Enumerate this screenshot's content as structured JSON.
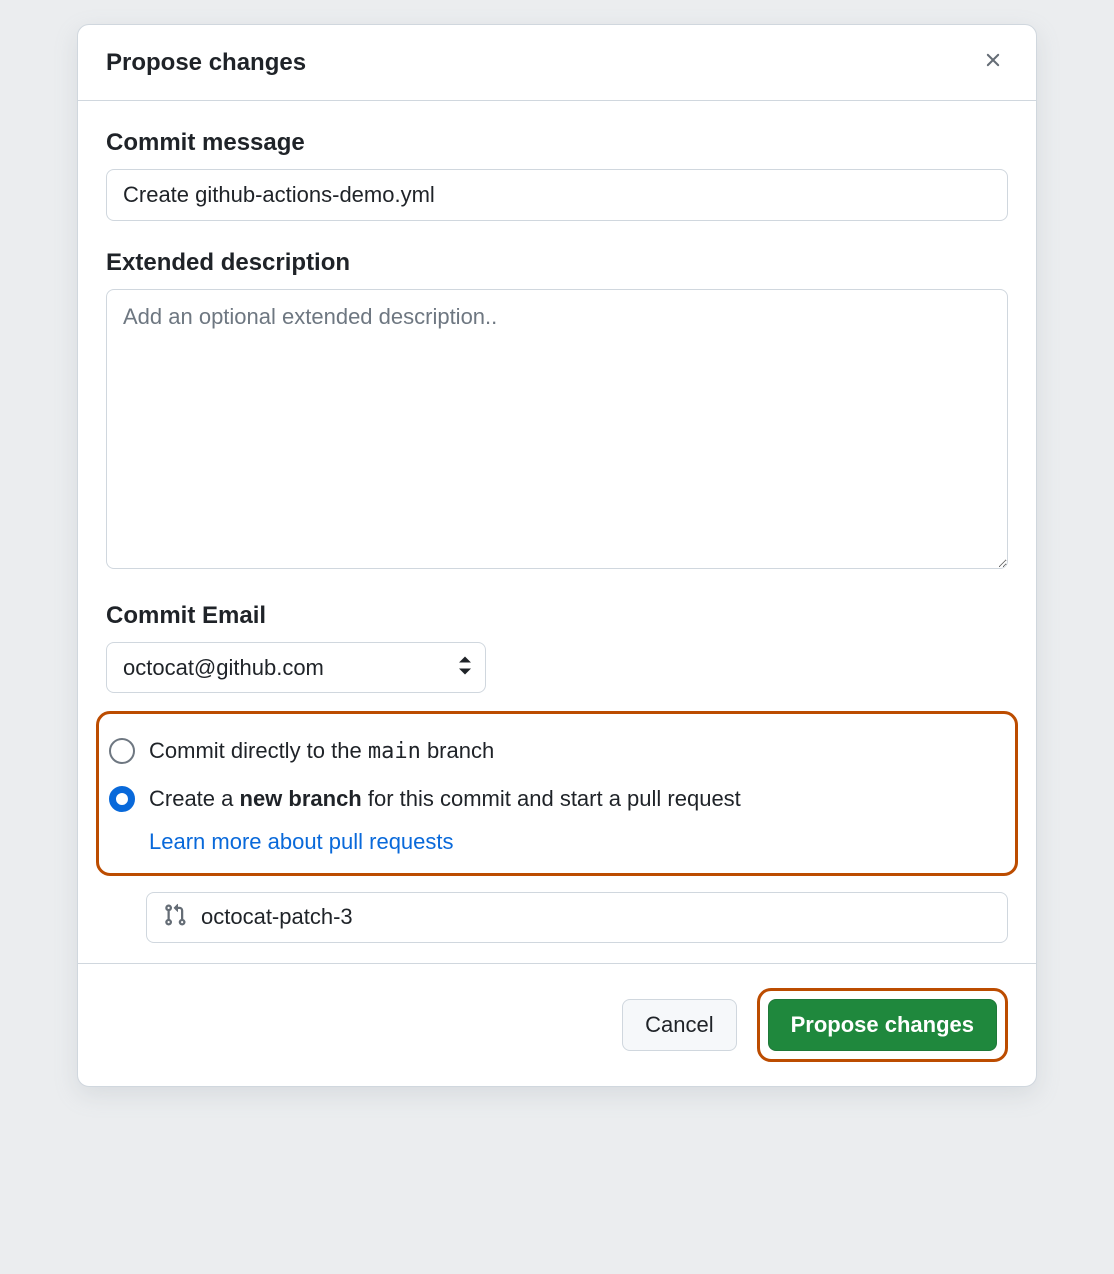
{
  "dialog": {
    "title": "Propose changes"
  },
  "commit_message": {
    "label": "Commit message",
    "value": "Create github-actions-demo.yml"
  },
  "extended_description": {
    "label": "Extended description",
    "placeholder": "Add an optional extended description.."
  },
  "commit_email": {
    "label": "Commit Email",
    "value": "octocat@github.com"
  },
  "branch_options": {
    "direct_prefix": "Commit directly to the ",
    "direct_branch": "main",
    "direct_suffix": " branch",
    "create_prefix": "Create a ",
    "create_bold": "new branch",
    "create_suffix": " for this commit and start a pull request",
    "learn_more": "Learn more about pull requests"
  },
  "branch_name": {
    "value": "octocat-patch-3"
  },
  "footer": {
    "cancel": "Cancel",
    "submit": "Propose changes"
  }
}
